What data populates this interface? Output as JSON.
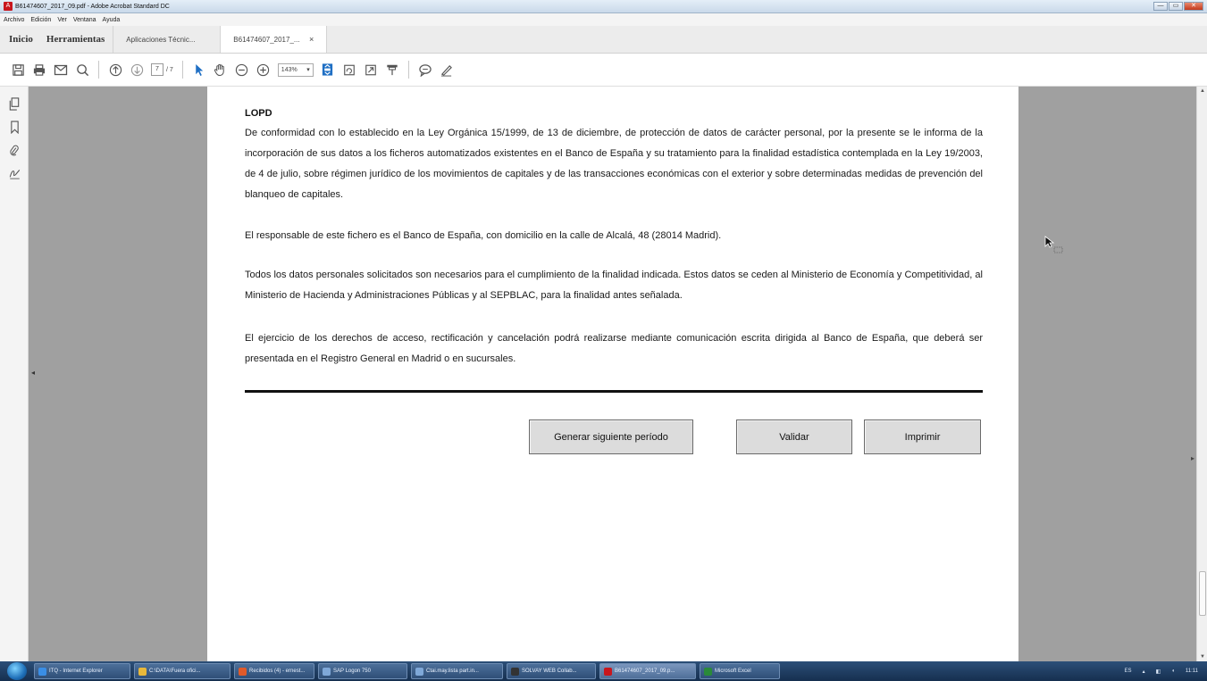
{
  "window": {
    "title": "B61474607_2017_09.pdf - Adobe Acrobat Standard DC",
    "buttons": {
      "minimize": "—",
      "maximize": "▭",
      "close": "✕"
    }
  },
  "menu": [
    "Archivo",
    "Edición",
    "Ver",
    "Ventana",
    "Ayuda"
  ],
  "tabs": {
    "home": "Inicio",
    "tools": "Herramientas",
    "doc1": "Aplicaciones Técnic...",
    "doc2": "B61474607_2017_...",
    "close": "×"
  },
  "toolbar": {
    "page_current": "7",
    "page_total": "/ 7",
    "zoom": "143%",
    "icons": [
      "save-icon",
      "print-icon",
      "email-icon",
      "search-icon",
      "page-up-icon",
      "page-down-icon",
      "select-arrow-icon",
      "hand-icon",
      "zoom-out-icon",
      "zoom-in-icon",
      "fit-page-icon",
      "rotate-icon",
      "fullscreen-icon",
      "stamp-icon",
      "comment-icon",
      "pen-icon"
    ]
  },
  "document": {
    "heading": "LOPD",
    "paragraphs": [
      "De conformidad con lo establecido en la Ley Orgánica 15/1999, de 13 de diciembre, de protección de datos de carácter personal, por la presente se le informa de la incorporación de sus datos a los ficheros automatizados existentes en el Banco de España y su tratamiento para la finalidad estadística contemplada en la Ley 19/2003, de 4 de julio, sobre régimen jurídico de los movimientos de capitales y de las transacciones económicas con el exterior y sobre determinadas medidas de prevención del blanqueo de capitales.",
      "El responsable de este fichero es el Banco de España, con domicilio en la calle de Alcalá, 48 (28014 Madrid).",
      "Todos los datos personales solicitados son necesarios para el cumplimiento de la finalidad indicada. Estos datos se ceden al Ministerio de Economía y Competitividad, al Ministerio de Hacienda y Administraciones Públicas y al SEPBLAC, para la finalidad antes señalada.",
      "El ejercicio de los derechos de acceso, rectificación y cancelación podrá realizarse mediante comunicación escrita dirigida al Banco de España, que deberá ser presentada en el Registro General en Madrid o en sucursales."
    ],
    "buttons": {
      "generate": "Generar siguiente período",
      "validate": "Validar",
      "print": "Imprimir"
    }
  },
  "taskbar": {
    "items": [
      {
        "label": "ITQ - Internet Explorer",
        "color": "#3a8ee6"
      },
      {
        "label": "C:\\DATA\\Fuera ofici...",
        "color": "#e8b83a"
      },
      {
        "label": "Recibidos (4) - ernest...",
        "color": "#e05a2a"
      },
      {
        "label": "SAP Logon 750",
        "color": "#7fa8d8"
      },
      {
        "label": "Ctai.may.lista part.in...",
        "color": "#7fa8d8"
      },
      {
        "label": "SOLVAY WEB Collab...",
        "color": "#333333"
      },
      {
        "label": "B61474607_2017_09.p...",
        "color": "#c8161d"
      },
      {
        "label": "Microsoft Excel",
        "color": "#2a8a3a"
      }
    ],
    "tray": {
      "lang": "ES",
      "time": "11:11"
    }
  }
}
